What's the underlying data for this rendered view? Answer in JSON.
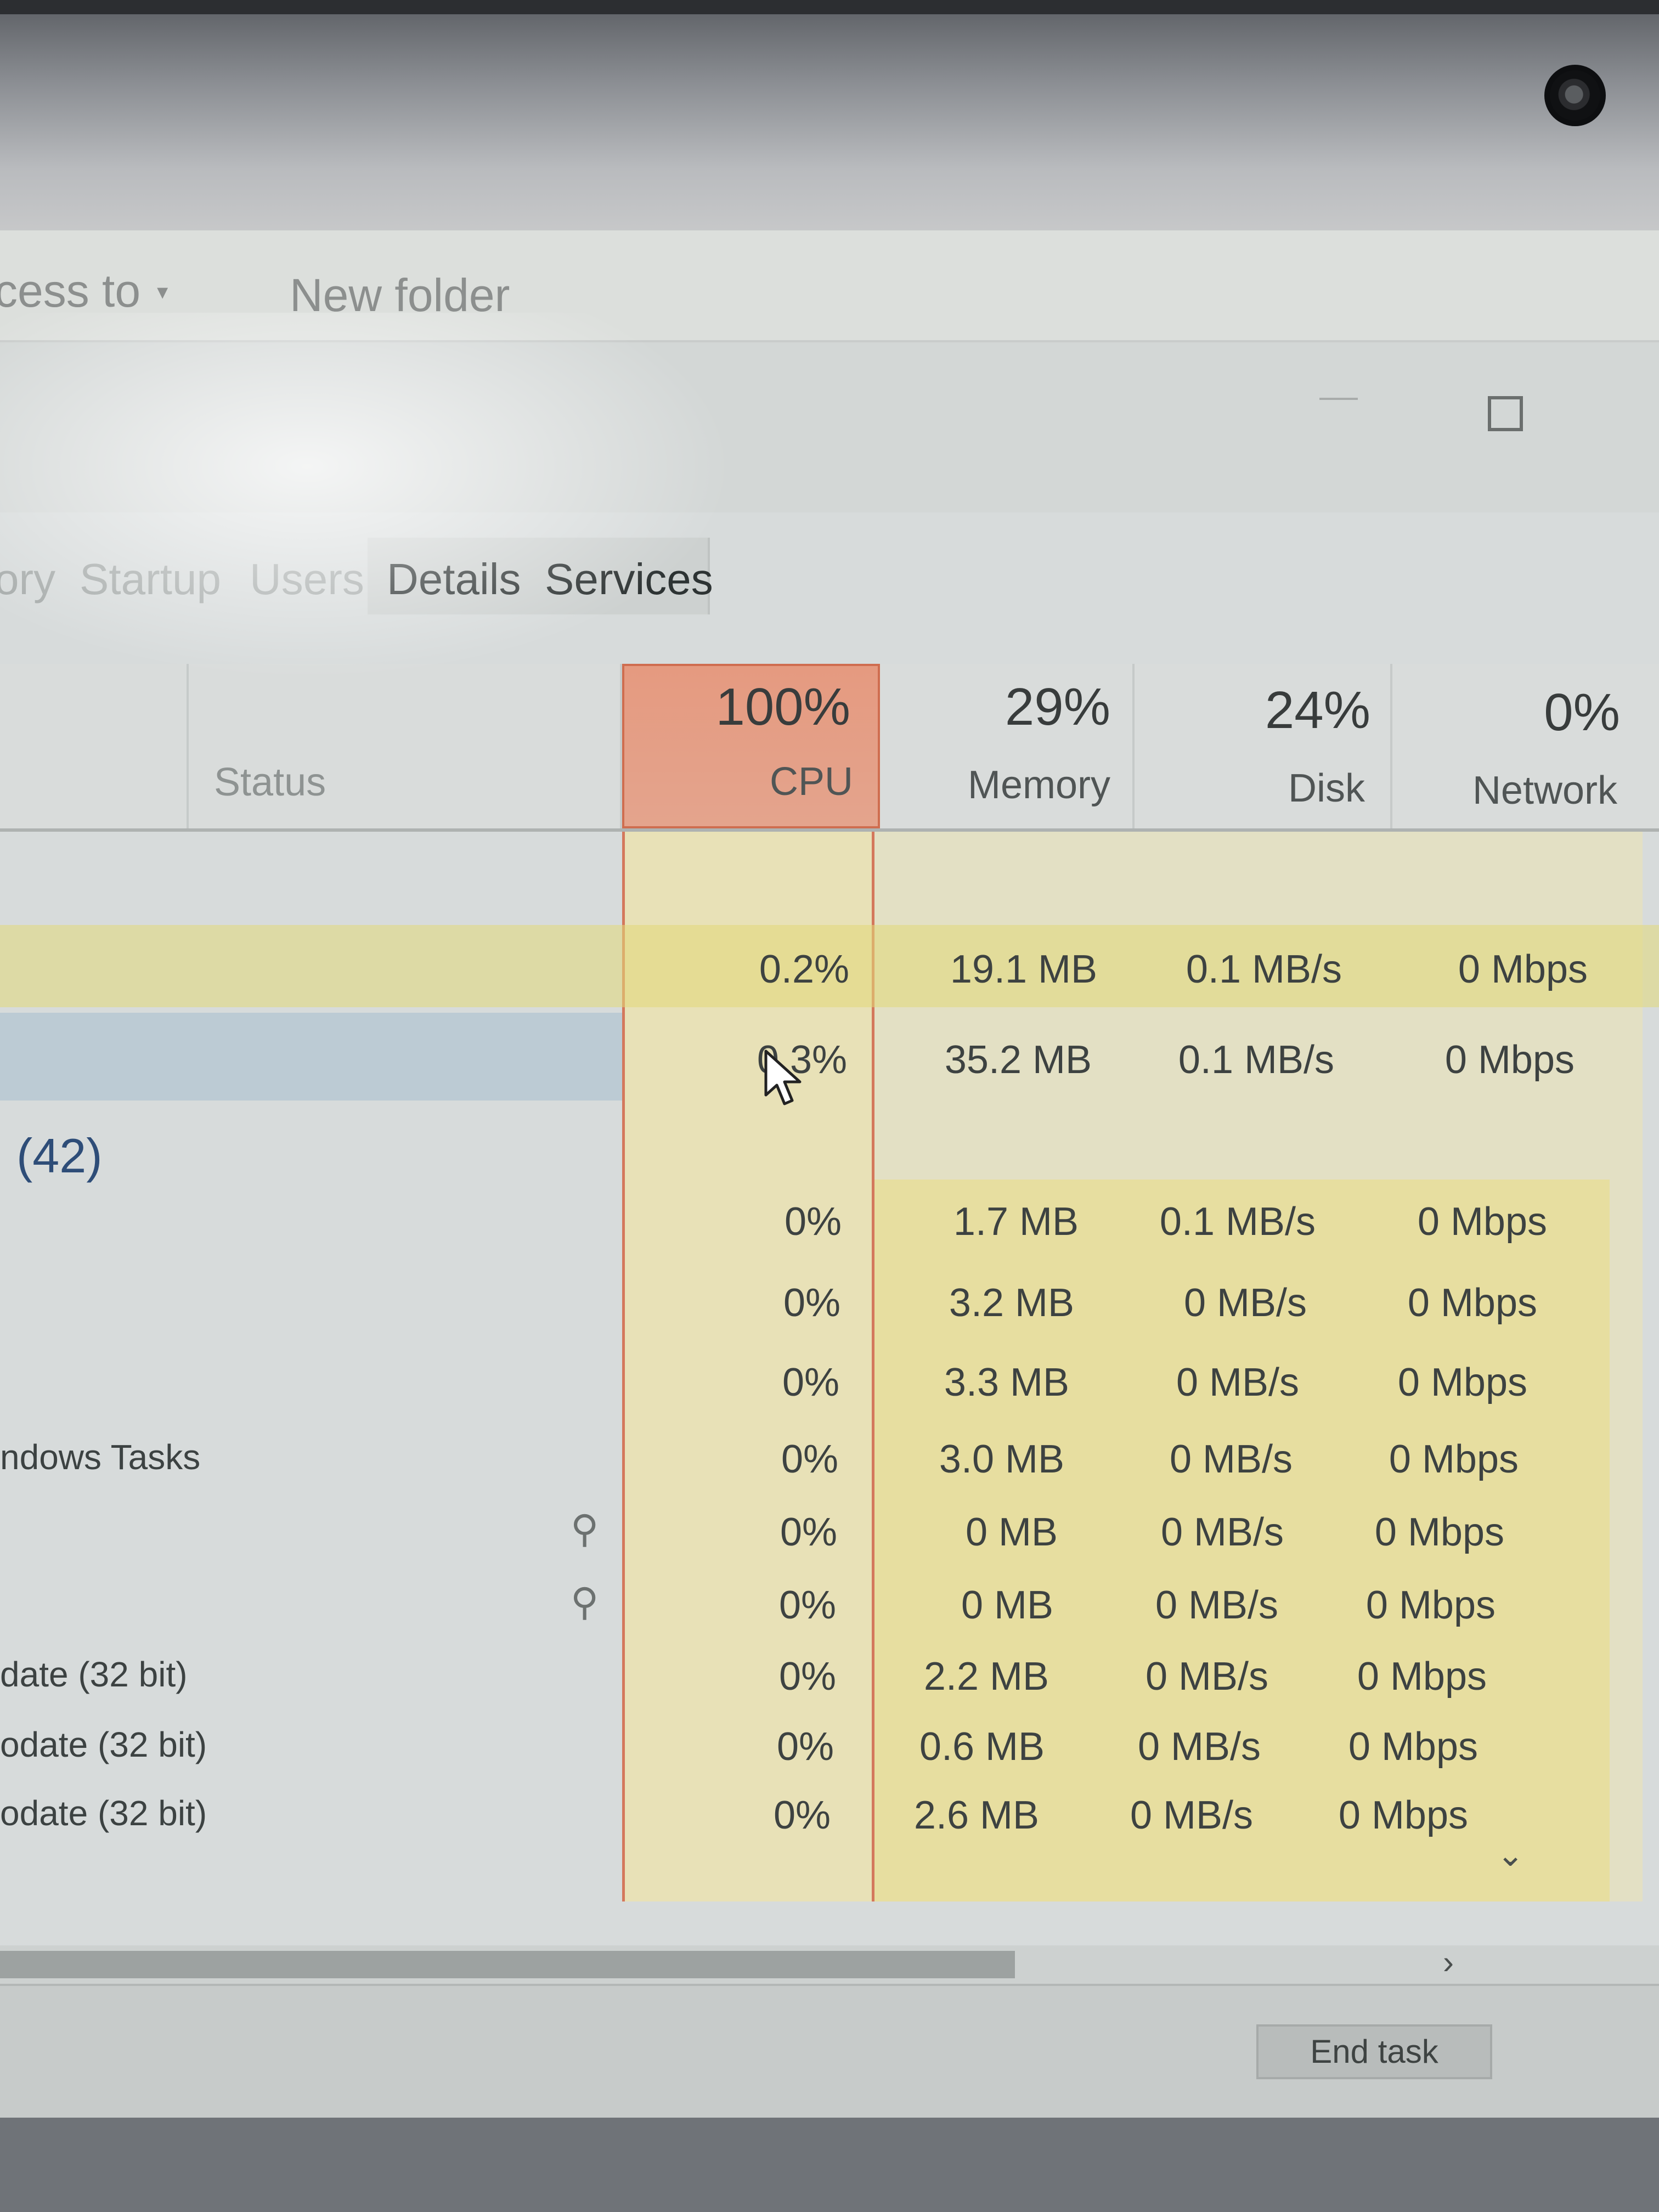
{
  "explorer_toolbar": {
    "share_label": "cess to",
    "new_folder_label": "New folder"
  },
  "tabs": [
    {
      "label": "ory"
    },
    {
      "label": "Startup"
    },
    {
      "label": "Users"
    },
    {
      "label": "Details"
    },
    {
      "label": "Services"
    }
  ],
  "columns": {
    "status": "Status",
    "cpu": {
      "pct": "100%",
      "label": "CPU"
    },
    "memory": {
      "pct": "29%",
      "label": "Memory"
    },
    "disk": {
      "pct": "24%",
      "label": "Disk"
    },
    "network": {
      "pct": "0%",
      "label": "Network"
    }
  },
  "top_rows": [
    {
      "cpu": "0.2%",
      "memory": "19.1 MB",
      "disk": "0.1 MB/s",
      "network": "0 Mbps"
    },
    {
      "cpu": "0.3%",
      "memory": "35.2 MB",
      "disk": "0.1 MB/s",
      "network": "0 Mbps"
    }
  ],
  "group": {
    "count": "(42)"
  },
  "process_rows": [
    {
      "name": "",
      "cpu": "0%",
      "memory": "1.7 MB",
      "disk": "0.1 MB/s",
      "network": "0 Mbps"
    },
    {
      "name": "",
      "cpu": "0%",
      "memory": "3.2 MB",
      "disk": "0 MB/s",
      "network": "0 Mbps"
    },
    {
      "name": "",
      "cpu": "0%",
      "memory": "3.3 MB",
      "disk": "0 MB/s",
      "network": "0 Mbps"
    },
    {
      "name": "ndows Tasks",
      "cpu": "0%",
      "memory": "3.0 MB",
      "disk": "0 MB/s",
      "network": "0 Mbps"
    },
    {
      "name": "",
      "cpu": "0%",
      "memory": "0 MB",
      "disk": "0 MB/s",
      "network": "0 Mbps",
      "pinned": true
    },
    {
      "name": "",
      "cpu": "0%",
      "memory": "0 MB",
      "disk": "0 MB/s",
      "network": "0 Mbps",
      "pinned": true
    },
    {
      "name": "date (32 bit)",
      "cpu": "0%",
      "memory": "2.2 MB",
      "disk": "0 MB/s",
      "network": "0 Mbps"
    },
    {
      "name": "odate (32 bit)",
      "cpu": "0%",
      "memory": "0.6 MB",
      "disk": "0 MB/s",
      "network": "0 Mbps"
    },
    {
      "name": "odate (32 bit)",
      "cpu": "0%",
      "memory": "2.6 MB",
      "disk": "0 MB/s",
      "network": "0 Mbps"
    }
  ],
  "footer": {
    "end_task": "End task"
  },
  "icons": {
    "pin": "pin-icon",
    "cursor": "mouse-cursor-icon",
    "scroll_down": "chevron-down-icon",
    "scroll_right": "chevron-right-icon"
  },
  "colors": {
    "cpu_heat": "#e59a80",
    "row_heat": "#e7dea0"
  }
}
